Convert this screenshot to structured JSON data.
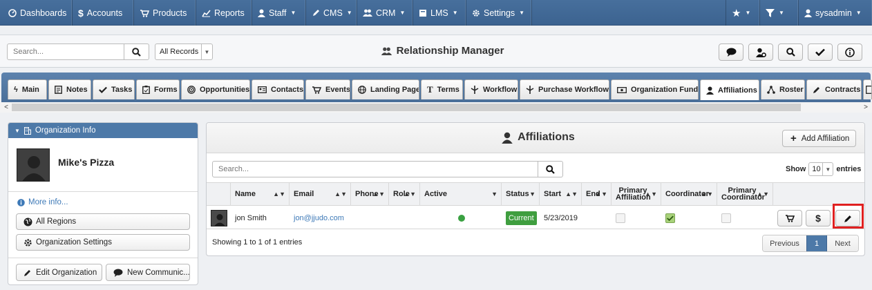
{
  "colors": {
    "nav": "#476f9c",
    "accent": "#4d79a8",
    "status_green": "#3f9e3f",
    "highlight": "#e02020"
  },
  "topnav": {
    "items": [
      {
        "label": "Dashboards",
        "icon": "dashboard-icon"
      },
      {
        "label": "Accounts",
        "icon": "dollar-icon"
      },
      {
        "label": "Products",
        "icon": "cart-icon"
      },
      {
        "label": "Reports",
        "icon": "chart-icon"
      },
      {
        "label": "Staff",
        "icon": "user-icon"
      },
      {
        "label": "CMS",
        "icon": "pencil-icon"
      },
      {
        "label": "CRM",
        "icon": "users-icon"
      },
      {
        "label": "LMS",
        "icon": "book-icon"
      },
      {
        "label": "Settings",
        "icon": "gear-icon"
      }
    ],
    "user": "sysadmin"
  },
  "search": {
    "placeholder": "Search...",
    "records_select": "All Records"
  },
  "page_title": "Relationship Manager",
  "tabs": [
    {
      "label": "Main",
      "icon": "bolt-icon"
    },
    {
      "label": "Notes",
      "icon": "notes-icon"
    },
    {
      "label": "Tasks",
      "icon": "check-icon"
    },
    {
      "label": "Forms",
      "icon": "clipboard-icon"
    },
    {
      "label": "Opportunities",
      "icon": "target-icon"
    },
    {
      "label": "Contacts",
      "icon": "contact-card-icon"
    },
    {
      "label": "Events",
      "icon": "cart-icon"
    },
    {
      "label": "Landing Page",
      "icon": "globe-icon"
    },
    {
      "label": "Terms",
      "icon": "text-icon"
    },
    {
      "label": "Workflow",
      "icon": "workflow-icon"
    },
    {
      "label": "Purchase Workflows",
      "icon": "workflow-icon"
    },
    {
      "label": "Organization Funds",
      "icon": "money-icon"
    },
    {
      "label": "Affiliations",
      "icon": "user-icon"
    },
    {
      "label": "Roster",
      "icon": "roster-icon"
    },
    {
      "label": "Contracts",
      "icon": "pen-icon"
    }
  ],
  "org_panel": {
    "header": "Organization Info",
    "name": "Mike's Pizza",
    "more_info": "More info...",
    "all_regions": "All Regions",
    "org_settings": "Organization Settings",
    "edit_org": "Edit Organization",
    "new_comm": "New Communic..."
  },
  "affiliations": {
    "title": "Affiliations",
    "add_button": "Add Affiliation",
    "search_placeholder": "Search...",
    "show_label": "Show",
    "show_value": "10",
    "entries_label": "entries",
    "columns": {
      "name": "Name",
      "email": "Email",
      "phone": "Phone",
      "role": "Role",
      "active": "Active",
      "status": "Status",
      "start": "Start",
      "end": "End",
      "primary_affiliation": "Primary Affiliation",
      "coordinator": "Coordinator",
      "primary_coordinator": "Primary Coordinator"
    },
    "rows": [
      {
        "name": "jon Smith",
        "email": "jon@jjudo.com",
        "phone": "",
        "role": "",
        "active": true,
        "status": "Current",
        "start": "5/23/2019",
        "end": "",
        "primary_affiliation": false,
        "coordinator": true,
        "primary_coordinator": false
      }
    ],
    "info": "Showing 1 to 1 of 1 entries",
    "pager": {
      "previous": "Previous",
      "current": "1",
      "next": "Next"
    }
  }
}
